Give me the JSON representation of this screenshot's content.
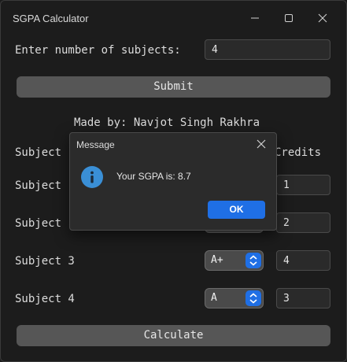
{
  "window": {
    "title": "SGPA Calculator"
  },
  "main": {
    "num_subjects_label": "Enter number of subjects:",
    "num_subjects_value": "4",
    "submit_label": "Submit",
    "credit_text": "Made by: Navjot Singh Rakhra",
    "header_subject": "Subject",
    "header_credits": "Credits",
    "calculate_label": "Calculate"
  },
  "rows": [
    {
      "label": "Subject",
      "grade": "",
      "credits": "1"
    },
    {
      "label": "Subject",
      "grade": "",
      "credits": "2"
    },
    {
      "label": "Subject 3",
      "grade": "A+",
      "credits": "4"
    },
    {
      "label": "Subject 4",
      "grade": "A",
      "credits": "3"
    }
  ],
  "dialog": {
    "title": "Message",
    "message": "Your SGPA is: 8.7",
    "ok_label": "OK"
  },
  "colors": {
    "accent": "#1f6fe5",
    "background": "#1c1c1c",
    "button": "#565656"
  }
}
